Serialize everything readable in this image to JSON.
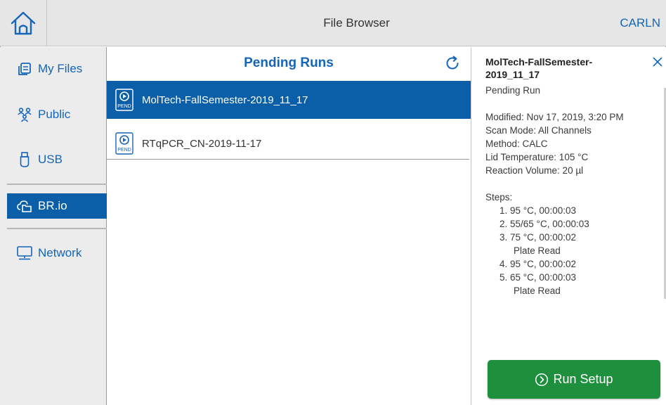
{
  "header": {
    "home_icon": "home-icon",
    "title": "File Browser",
    "user": "CARLN"
  },
  "sidebar": {
    "items": [
      {
        "label": "My Files",
        "icon": "my-files-icon"
      },
      {
        "label": "Public",
        "icon": "public-icon"
      },
      {
        "label": "USB",
        "icon": "usb-icon"
      },
      {
        "label": "BR.io",
        "icon": "cloud-folder-icon"
      },
      {
        "label": "Network",
        "icon": "network-icon"
      }
    ],
    "active_index": 3
  },
  "list": {
    "title": "Pending Runs",
    "refresh_icon": "refresh-icon",
    "pend_badge": "PEND",
    "rows": [
      {
        "name": "MolTech-FallSemester-2019_11_17",
        "selected": true
      },
      {
        "name": "RTqPCR_CN-2019-11-17",
        "selected": false
      }
    ]
  },
  "detail": {
    "name": "MolTech-FallSemester-2019_11_17",
    "type": "Pending Run",
    "modified": "Modified: Nov 17, 2019, 3:20 PM",
    "scan_mode": "Scan Mode: All Channels",
    "method": "Method: CALC",
    "lid_temp": "Lid Temperature: 105 °C",
    "reaction_volume": "Reaction Volume: 20 µl",
    "steps_label": "Steps:",
    "steps": [
      "1.  95 °C, 00:00:03",
      "2.  55/65 °C, 00:00:03",
      "3.  75 °C, 00:00:02",
      "Plate Read",
      "4.  95 °C, 00:00:02",
      "5.  65 °C, 00:00:03",
      "Plate Read"
    ]
  },
  "actions": {
    "run_setup_label": "Run Setup"
  },
  "colors": {
    "accent": "#1565b8",
    "selected": "#0b5fa8",
    "primary_button": "#1e8f3c"
  }
}
